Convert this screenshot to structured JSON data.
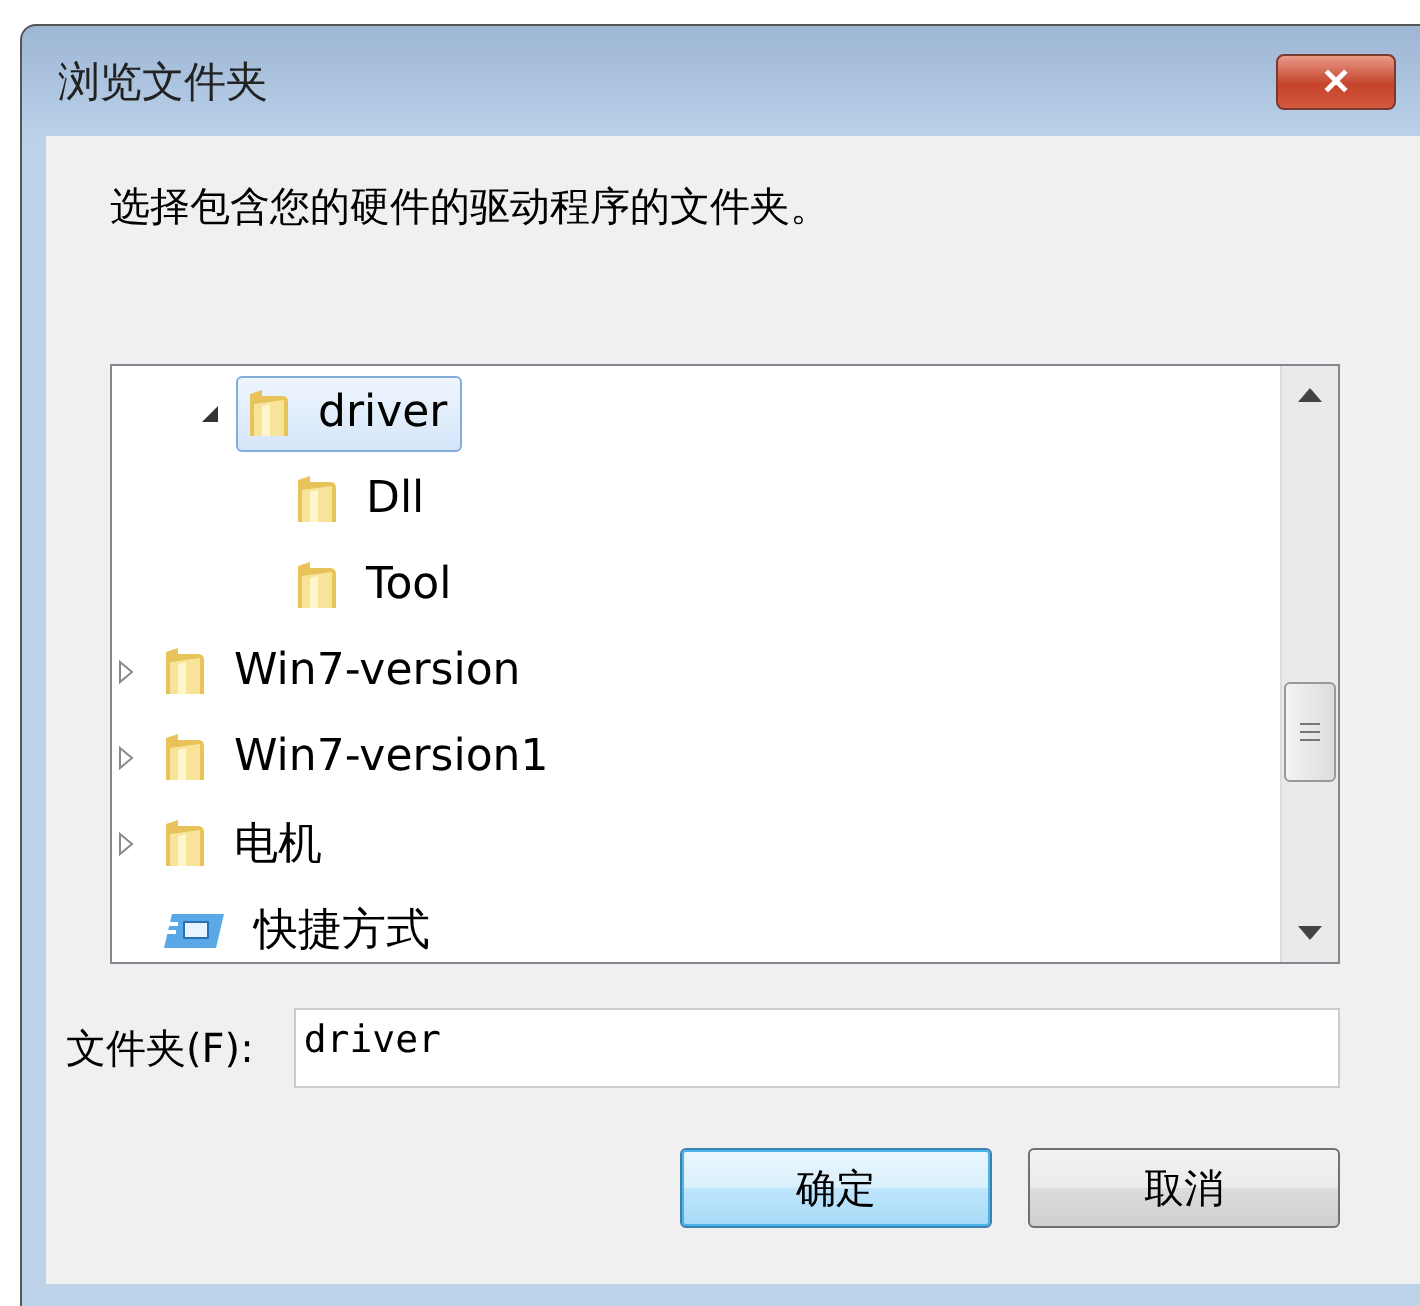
{
  "window": {
    "title": "浏览文件夹",
    "close": "✕"
  },
  "instruction": "选择包含您的硬件的驱动程序的文件夹。",
  "tree": {
    "items": [
      {
        "children": [
          {
            "children": [
              {
                "label": "driver",
                "kind": "folder",
                "expanded": true,
                "selected": true,
                "children": [
                  {
                    "label": "Dll",
                    "kind": "folder",
                    "selected": false
                  },
                  {
                    "label": "Tool",
                    "kind": "folder",
                    "selected": false
                  }
                ]
              }
            ]
          }
        ]
      },
      {
        "label": "Win7-version",
        "kind": "folder",
        "expanded": false,
        "selected": false
      },
      {
        "label": "Win7-version1",
        "kind": "folder",
        "expanded": false,
        "selected": false
      },
      {
        "label": "电机",
        "kind": "folder",
        "expanded": false,
        "selected": false
      },
      {
        "label": "快捷方式",
        "kind": "shortcut",
        "selected": false
      }
    ]
  },
  "folder_field": {
    "label": "文件夹(F):",
    "value": "driver"
  },
  "buttons": [
    {
      "label": "确定",
      "default": true
    },
    {
      "label": "取消",
      "default": false
    }
  ]
}
